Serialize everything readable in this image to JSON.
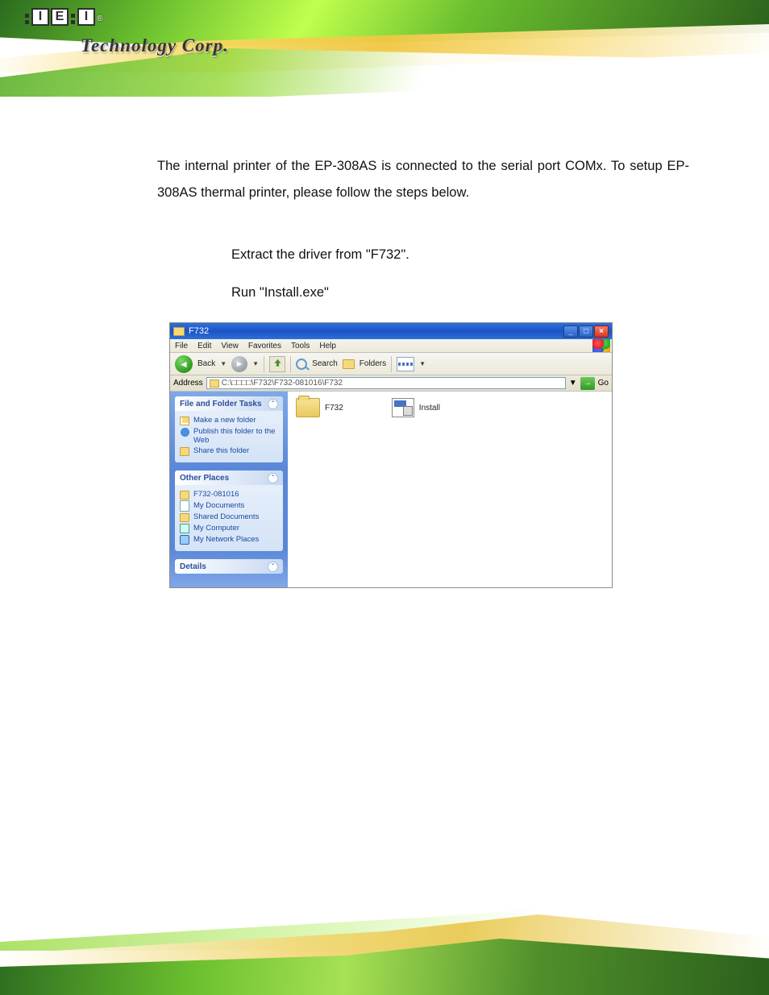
{
  "header": {
    "tagline": "Technology Corp."
  },
  "doc": {
    "intro": "The internal printer of the EP-308AS is connected to the serial port COMx. To setup EP-308AS thermal printer, please follow the steps below.",
    "step1": "Extract the driver from \"F732\".",
    "step2": "Run \"Install.exe\""
  },
  "explorer": {
    "title": "F732",
    "menu": {
      "file": "File",
      "edit": "Edit",
      "view": "View",
      "favorites": "Favorites",
      "tools": "Tools",
      "help": "Help"
    },
    "toolbar": {
      "back_label": "Back",
      "search_label": "Search",
      "folders_label": "Folders"
    },
    "address": {
      "label": "Address",
      "path": "C:\\□□□□\\F732\\F732-081016\\F732",
      "go": "Go"
    },
    "side": {
      "tasks_title": "File and Folder Tasks",
      "tasks": {
        "new": "Make a new folder",
        "publish": "Publish this folder to the Web",
        "share": "Share this folder"
      },
      "places_title": "Other Places",
      "places": {
        "p1": "F732-081016",
        "p2": "My Documents",
        "p3": "Shared Documents",
        "p4": "My Computer",
        "p5": "My Network Places"
      },
      "details_title": "Details"
    },
    "items": {
      "folder": "F732",
      "install": "Install"
    }
  }
}
